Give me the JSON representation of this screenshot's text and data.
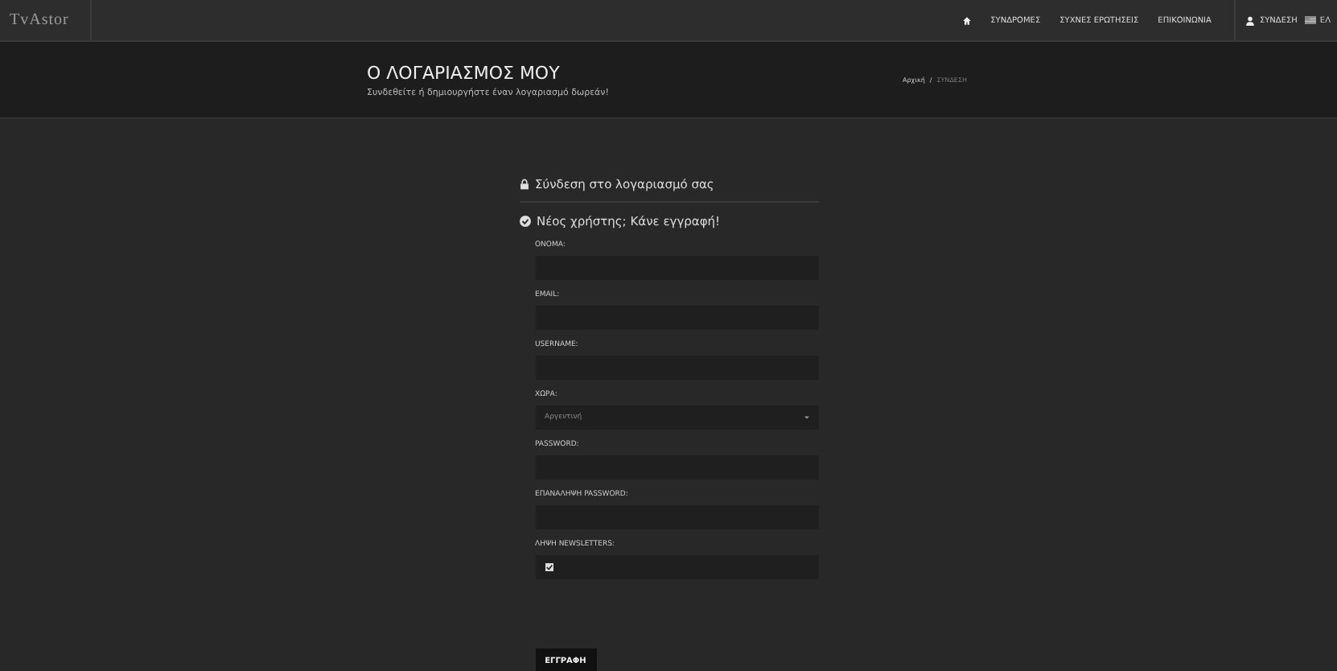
{
  "logo": "TvAstor",
  "nav": {
    "items": [
      "ΣΥΝΔΡΟΜΕΣ",
      "ΣΥΧΝΕΣ ΕΡΩΤΗΣΕΙΣ",
      "ΕΠΙΚΟΙΝΩΝΙΑ"
    ],
    "login": "ΣΥΝΔΕΣΗ",
    "language": "ΕΛ"
  },
  "banner": {
    "title": "Ο ΛΟΓΑΡΙΑΣΜΟΣ ΜΟΥ",
    "subtitle": "Συνδεθείτε ή δημιουργήστε έναν λογαριασμό δωρεάν!",
    "breadcrumb": [
      "Αρχική",
      "ΣΥΝΔΕΣΗ"
    ],
    "breadcrumb_separator": "/"
  },
  "login_heading": "Σύνδεση στο λογαριασμό σας",
  "register_heading": "Νέος χρήστης; Κάνε εγγραφή!",
  "fields": [
    {
      "kind": "text",
      "label": "ΟΝΟΜΑ:"
    },
    {
      "kind": "text",
      "label": "EMAIL:"
    },
    {
      "kind": "text",
      "label": "USERNAME:"
    },
    {
      "kind": "select",
      "label": "ΧΩΡΑ:",
      "value": "Αργεντινή"
    },
    {
      "kind": "password",
      "label": "PASSWORD:"
    },
    {
      "kind": "password",
      "label": "ΕΠΑΝΑΛΗΨΗ PASSWORD:"
    },
    {
      "kind": "checkbox",
      "label": "ΛΗΨΗ NEWSLETTERS:",
      "checked": true
    }
  ],
  "submit": "ΕΓΓΡΑΦΗ"
}
